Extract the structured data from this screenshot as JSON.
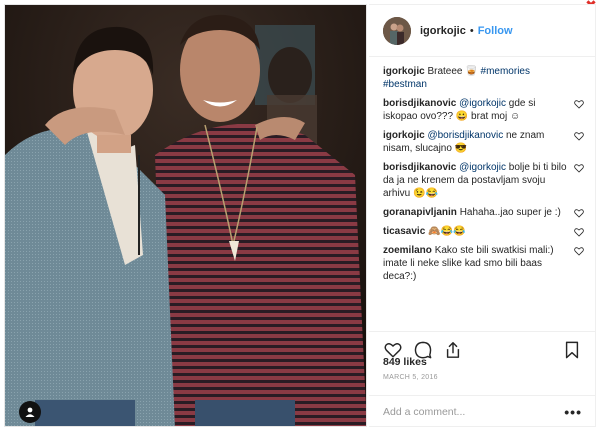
{
  "window": {
    "close_glyph": "✖"
  },
  "post": {
    "username": "igorkojic",
    "follow_label": "Follow",
    "separator": "•",
    "caption": {
      "user": "igorkojic",
      "text": "Brateee ",
      "emoji": "🥃",
      "hashtags": "#memories #bestman"
    },
    "comments": [
      {
        "user": "borisdjikanovic",
        "mention": "@igorkojic",
        "text": " gde si iskopao ovo??? 😀 brat moj ☺"
      },
      {
        "user": "igorkojic",
        "mention": "@borisdjikanovic",
        "text": " ne znam nisam, slucajno 😎"
      },
      {
        "user": "borisdjikanovic",
        "mention": "@igorkojic",
        "text": " bolje bi ti bilo da ja ne krenem da postavljam svoju arhivu 😉😂"
      },
      {
        "user": "goranapivljanin",
        "mention": "",
        "text": "Hahaha..jao super je :)"
      },
      {
        "user": "ticasavic",
        "mention": "",
        "text": "🙈😂😂"
      },
      {
        "user": "zoemilano",
        "mention": "",
        "text": "Kako ste bili swatkisi mali:) imate li neke slike kad smo bili baas deca?:)"
      }
    ],
    "likes": "849 likes",
    "date": "MARCH 5, 2016",
    "add_comment_placeholder": "Add a comment...",
    "more_glyph": "•••"
  },
  "icons": {
    "like": "heart-icon",
    "comment": "comment-icon",
    "share": "share-icon",
    "save": "bookmark-icon",
    "user_tag": "user-icon",
    "comment_like": "heart-icon"
  },
  "colors": {
    "link": "#3897f0",
    "mention": "#003569",
    "close": "#e0302a",
    "date": "#999999"
  }
}
